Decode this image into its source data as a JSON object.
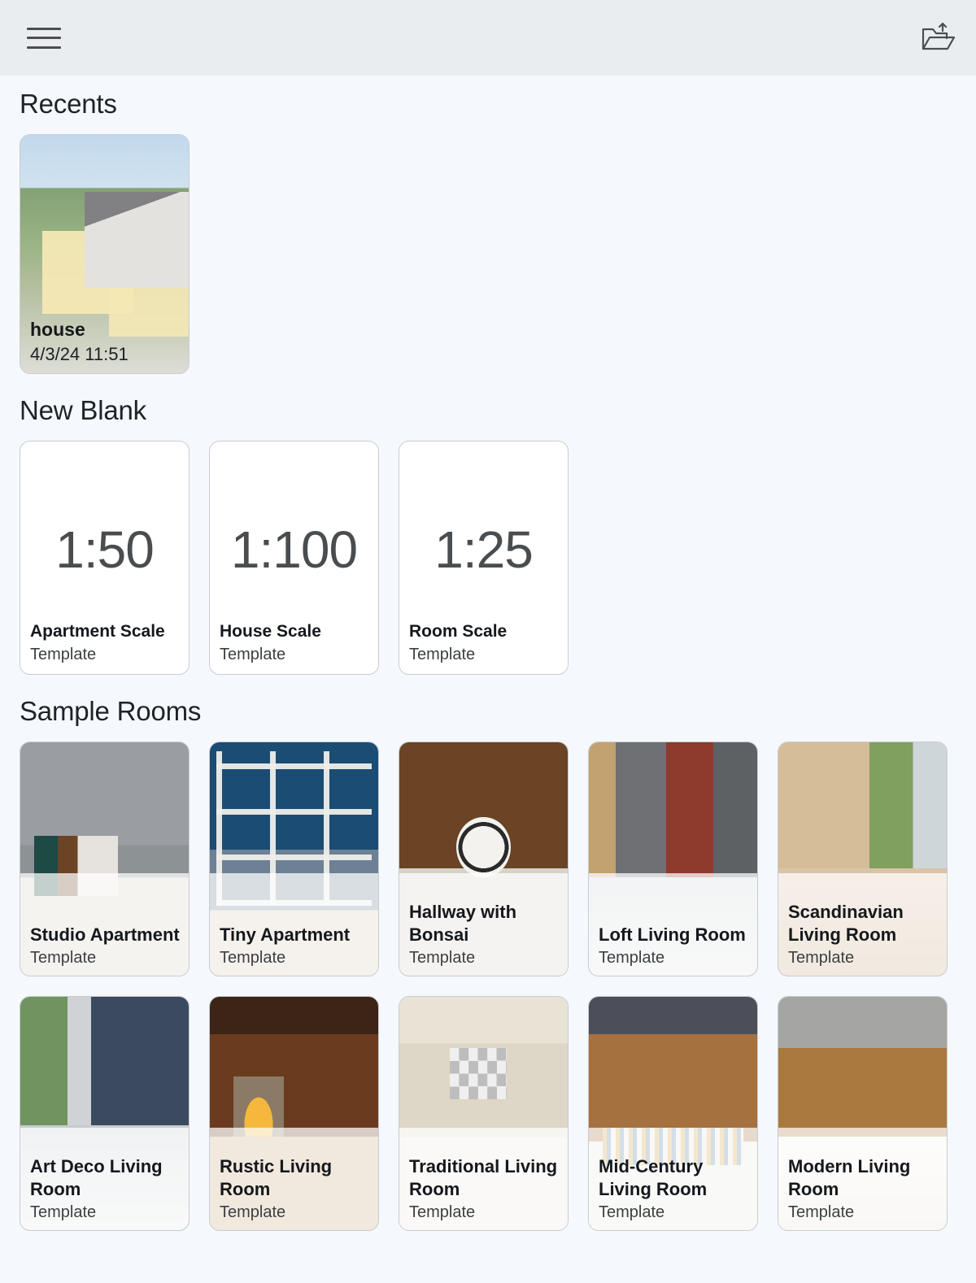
{
  "topbar": {
    "menu_icon": "hamburger-menu-icon",
    "open_icon": "open-folder-upload-icon"
  },
  "sections": {
    "recents": {
      "title": "Recents"
    },
    "new_blank": {
      "title": "New Blank"
    },
    "sample_rooms": {
      "title": "Sample Rooms"
    }
  },
  "recents": [
    {
      "name": "house",
      "timestamp": "4/3/24 11:51",
      "thumb": "t-house"
    }
  ],
  "new_blank": [
    {
      "scale": "1:50",
      "title": "Apartment Scale",
      "sub": "Template"
    },
    {
      "scale": "1:100",
      "title": "House Scale",
      "sub": "Template"
    },
    {
      "scale": "1:25",
      "title": "Room Scale",
      "sub": "Template"
    }
  ],
  "sample_rooms_row1": [
    {
      "title": "Studio Apartment",
      "sub": "Template",
      "thumb": "t-studio"
    },
    {
      "title": "Tiny Apartment",
      "sub": "Template",
      "thumb": "t-tiny"
    },
    {
      "title": "Hallway with Bonsai",
      "sub": "Template",
      "thumb": "t-hallway"
    },
    {
      "title": "Loft Living Room",
      "sub": "Template",
      "thumb": "t-loft"
    },
    {
      "title": "Scandinavian Living Room",
      "sub": "Template",
      "thumb": "t-scandi"
    }
  ],
  "sample_rooms_row2": [
    {
      "title": "Art Deco Living Room",
      "sub": "Template",
      "thumb": "t-artdeco"
    },
    {
      "title": "Rustic Living Room",
      "sub": "Template",
      "thumb": "t-rustic"
    },
    {
      "title": "Traditional Living Room",
      "sub": "Template",
      "thumb": "t-trad"
    },
    {
      "title": "Mid-Century Living Room",
      "sub": "Template",
      "thumb": "t-mid"
    },
    {
      "title": "Modern Living Room",
      "sub": "Template",
      "thumb": "t-modern"
    }
  ],
  "colors": {
    "page_background": "#f5f8fd",
    "topbar_background": "#eaedf0",
    "card_border": "#c9ccd1",
    "heading_text": "#1f2328",
    "title_text": "#15181c",
    "sub_text": "#3c4043",
    "scale_text": "#4a4d50",
    "icon": "#4d4d4f"
  }
}
